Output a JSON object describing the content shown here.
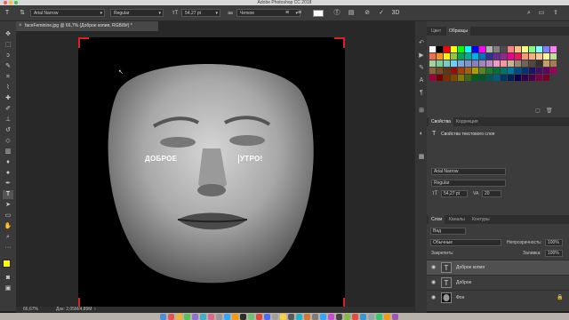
{
  "window": {
    "title": "Adobe Photoshop CC 2018"
  },
  "options_bar": {
    "font_family": "Arial Narrow",
    "font_style": "Regular",
    "font_size": "54,27 pt",
    "antialias": "Четкое"
  },
  "document": {
    "tab_title": "faceFeminine.jpg @ 66,7% (Доброе копия, RGB/8#) *"
  },
  "canvas": {
    "text_left": "ДОБРОЕ",
    "text_right": "УТРО!"
  },
  "status": {
    "zoom": "66,67%",
    "doc_info": "Док: 2,05M/4,89M"
  },
  "swatches_panel": {
    "tabs": [
      "Цвет",
      "Образцы"
    ],
    "active_tab": "Образцы",
    "colors": [
      "#ffffff",
      "#000000",
      "#ff0000",
      "#ffff00",
      "#00ff00",
      "#00ffff",
      "#0000ff",
      "#ff00ff",
      "#b3b3b3",
      "#808080",
      "#4d4d4d",
      "#ff7f7f",
      "#ffbf7f",
      "#ffff7f",
      "#7fff7f",
      "#7fffff",
      "#7f7fff",
      "#ff7fff",
      "#f26c4f",
      "#f7941d",
      "#fff200",
      "#8dc63f",
      "#00a651",
      "#00a99d",
      "#00aeef",
      "#0072bc",
      "#2e3192",
      "#662d91",
      "#92278f",
      "#ec008c",
      "#ed145b",
      "#f7977a",
      "#fbad82",
      "#fdc68c",
      "#fff79a",
      "#c4df9b",
      "#a3d39c",
      "#82ca9c",
      "#7accc8",
      "#6dcff6",
      "#7da7d9",
      "#8393ca",
      "#8781bd",
      "#a186be",
      "#bd8cbf",
      "#f49ac1",
      "#f5989d",
      "#c7b299",
      "#998675",
      "#736357",
      "#534741",
      "#37302d",
      "#c69c6d",
      "#a67c52",
      "#8c6239",
      "#754c24",
      "#603913",
      "#9e0b0f",
      "#a0410d",
      "#a36209",
      "#aba000",
      "#598527",
      "#1a7b30",
      "#007236",
      "#00746b",
      "#0076a3",
      "#004b80",
      "#003471",
      "#1b1464",
      "#440e62",
      "#630460",
      "#9e005d",
      "#9e0039",
      "#790000",
      "#7b2e00",
      "#7d4900",
      "#827b00",
      "#406618",
      "#005e20",
      "#005826",
      "#005952",
      "#005b7f",
      "#003663",
      "#002157",
      "#0d004c",
      "#32004b",
      "#4b0049",
      "#7b0046",
      "#7a0026"
    ]
  },
  "properties_panel": {
    "tabs": [
      "Свойства",
      "Коррекция"
    ],
    "active_tab": "Свойства",
    "header": "Свойства текстового слоя",
    "font_family": "Arial Narrow",
    "font_style": "Regular",
    "font_size": "54,27 pt",
    "tracking": "20"
  },
  "layers_panel": {
    "tabs": [
      "Слои",
      "Каналы",
      "Контуры"
    ],
    "active_tab": "Слои",
    "filter_label": "Вид",
    "blend_mode": "Обычные",
    "opacity_label": "Непрозрачность:",
    "opacity_value": "100%",
    "lock_label": "Закрепить:",
    "fill_label": "Заливка:",
    "fill_value": "100%",
    "layers": [
      {
        "name": "Доброе копия",
        "type": "text",
        "selected": true
      },
      {
        "name": "Доброе",
        "type": "text",
        "selected": false
      },
      {
        "name": "Фон",
        "type": "image",
        "selected": false
      }
    ]
  },
  "colors": {
    "crop_corner": "#e02020",
    "selected_layer": "#505050",
    "foreground": "#ffff00",
    "background": "#ffffff"
  }
}
